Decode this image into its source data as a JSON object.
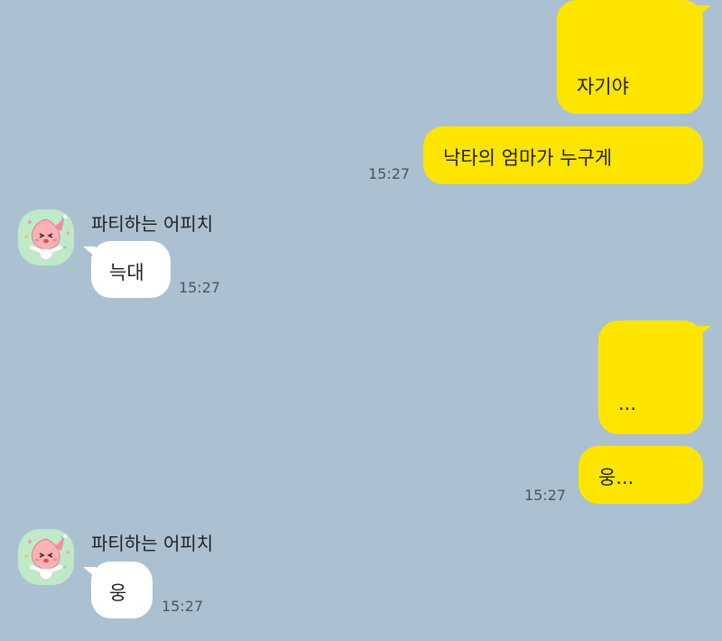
{
  "colors": {
    "background": "#abc1d1",
    "my_bubble": "#fee500",
    "their_bubble": "#ffffff",
    "avatar_bg": "#bfe9c7"
  },
  "messages": [
    {
      "sender": "me",
      "text": "자기야"
    },
    {
      "sender": "me",
      "text": "낙타의 엄마가 누구게",
      "time": "15:27"
    },
    {
      "sender": "friend",
      "name": "파티하는 어피치",
      "avatar_icon": "apeach-party-avatar-icon",
      "text": "늑대",
      "time": "15:27"
    },
    {
      "sender": "me",
      "text": "..."
    },
    {
      "sender": "me",
      "text": "웅...",
      "time": "15:27"
    },
    {
      "sender": "friend",
      "name": "파티하는 어피치",
      "avatar_icon": "apeach-party-avatar-icon",
      "text": "웅",
      "time": "15:27"
    }
  ]
}
